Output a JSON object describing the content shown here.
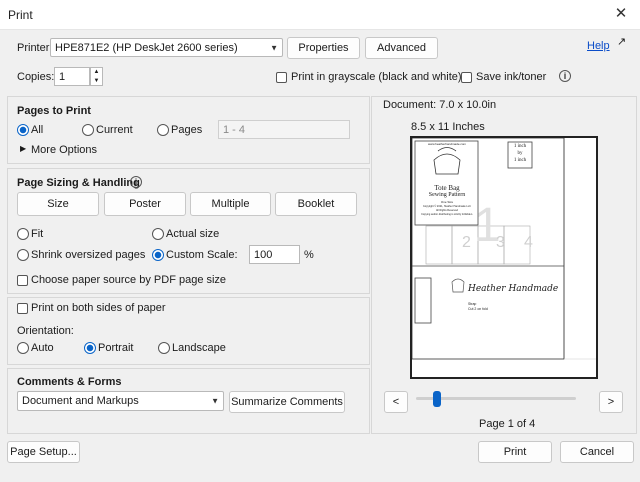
{
  "window": {
    "title": "Print"
  },
  "printer": {
    "label": "Printer:",
    "selected": "HPE871E2 (HP DeskJet 2600 series)",
    "properties": "Properties",
    "advanced": "Advanced",
    "help": "Help"
  },
  "copies": {
    "label": "Copies:",
    "value": "1"
  },
  "options": {
    "grayscale": "Print in grayscale (black and white)",
    "save_ink": "Save ink/toner"
  },
  "pages_to_print": {
    "title": "Pages to Print",
    "all": "All",
    "current": "Current",
    "pages": "Pages",
    "pages_placeholder": "1 - 4",
    "more": "More Options"
  },
  "sizing": {
    "title": "Page Sizing & Handling",
    "tabs": [
      "Size",
      "Poster",
      "Multiple",
      "Booklet"
    ],
    "fit": "Fit",
    "actual": "Actual size",
    "shrink": "Shrink oversized pages",
    "custom": "Custom Scale:",
    "scale_value": "100",
    "percent": "%",
    "paper_source": "Choose paper source by PDF page size"
  },
  "duplex": {
    "label": "Print on both sides of paper"
  },
  "orientation": {
    "title": "Orientation:",
    "auto": "Auto",
    "portrait": "Portrait",
    "landscape": "Landscape"
  },
  "comments": {
    "title": "Comments & Forms",
    "selected": "Document and Markups",
    "summarize": "Summarize Comments"
  },
  "preview": {
    "document_size": "Document: 7.0 x 10.0in",
    "paper_size": "8.5 x 11 Inches",
    "page_indicator": "Page 1 of 4",
    "prev": "<",
    "next": ">",
    "slider_fraction": 0.0
  },
  "sheet_text": {
    "url": "www.heatherhandmade.com",
    "pattern_title": "Tote Bag",
    "pattern_subtitle": "Sewing Pattern",
    "size": "One Size",
    "copyright": "Copyright © 2021, Heather Handmade LLC",
    "rights": "All Rights Reserved",
    "copy_note": "Copying and/or distributing is strictly forbidden.",
    "square_1": "1 inch",
    "square_2": "by",
    "square_3": "1 inch",
    "tile_numbers": [
      "1",
      "2",
      "3",
      "4"
    ],
    "brand": "Heather Handmade",
    "strap": "Strap",
    "cut": "Cut 2 on fold"
  },
  "footer": {
    "page_setup": "Page Setup...",
    "print": "Print",
    "cancel": "Cancel"
  }
}
